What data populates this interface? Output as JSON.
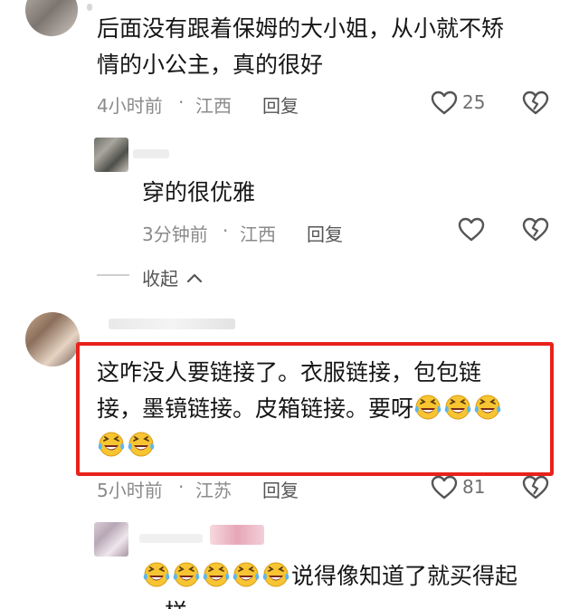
{
  "comments": [
    {
      "text_line1": "后面没有跟着保姆的大小姐，从小就不矫",
      "text_line2": "情的小公主，真的很好",
      "time": "4小时前",
      "location": "江西",
      "reply_label": "回复",
      "likes": "25"
    },
    {
      "text_line1": "穿的很优雅",
      "time": "3分钟前",
      "location": "江西",
      "reply_label": "回复"
    },
    {
      "text_line1": "这咋没人要链接了。衣服链接，包包链",
      "text_line2": "接，墨镜链接。皮箱链接。要呀",
      "time": "5小时前",
      "location": "江苏",
      "reply_label": "回复",
      "likes": "81"
    },
    {
      "text_line1": "说得像知道了就买得起",
      "text_line2": "…样"
    }
  ],
  "collapse_label": "收起",
  "separator": "·",
  "colors": {
    "highlight": "#e8221b",
    "emoji_face": "#f7c532"
  }
}
